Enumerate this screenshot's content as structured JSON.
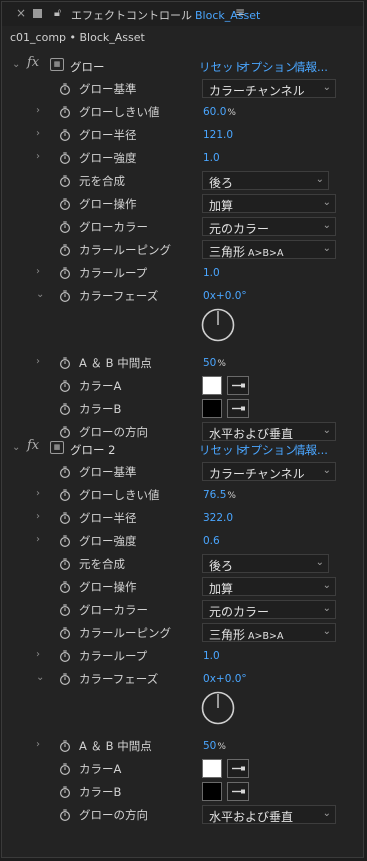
{
  "tab": {
    "title": "エフェクトコントロール",
    "asset": "Block_Asset"
  },
  "breadcrumb": "c01_comp • Block_Asset",
  "effects": [
    {
      "name": "グロー",
      "links": [
        "リセット",
        "オプション...",
        "情報..."
      ],
      "params": [
        {
          "label": "グロー基準",
          "type": "dropdown",
          "value": "カラーチャンネル"
        },
        {
          "label": "グローしきい値",
          "type": "number",
          "value": "60.0",
          "unit": "%",
          "expandable": true
        },
        {
          "label": "グロー半径",
          "type": "number",
          "value": "121.0",
          "expandable": true
        },
        {
          "label": "グロー強度",
          "type": "number",
          "value": "1.0",
          "expandable": true
        },
        {
          "label": "元を合成",
          "type": "dropdown",
          "value": "後ろ",
          "short": true
        },
        {
          "label": "グロー操作",
          "type": "dropdown",
          "value": "加算"
        },
        {
          "label": "グローカラー",
          "type": "dropdown",
          "value": "元のカラー"
        },
        {
          "label": "カラールーピング",
          "type": "dropdown",
          "value": "三角形",
          "value_suffix": "A>B>A"
        },
        {
          "label": "カラーループ",
          "type": "number",
          "value": "1.0",
          "expandable": true
        },
        {
          "label": "カラーフェーズ",
          "type": "angle",
          "value": "0",
          "value_extra": "x+0.0°",
          "expanded": true
        },
        {
          "label": "A ＆ B 中間点",
          "type": "number",
          "value": "50",
          "unit": "%",
          "expandable": true
        },
        {
          "label": "カラーA",
          "type": "color",
          "color": "#ffffff"
        },
        {
          "label": "カラーB",
          "type": "color",
          "color": "#000000"
        },
        {
          "label": "グローの方向",
          "type": "dropdown",
          "value": "水平および垂直"
        }
      ]
    },
    {
      "name": "グロー 2",
      "links": [
        "リセット",
        "オプション...",
        "情報..."
      ],
      "params": [
        {
          "label": "グロー基準",
          "type": "dropdown",
          "value": "カラーチャンネル"
        },
        {
          "label": "グローしきい値",
          "type": "number",
          "value": "76.5",
          "unit": "%",
          "expandable": true
        },
        {
          "label": "グロー半径",
          "type": "number",
          "value": "322.0",
          "expandable": true
        },
        {
          "label": "グロー強度",
          "type": "number",
          "value": "0.6",
          "expandable": true
        },
        {
          "label": "元を合成",
          "type": "dropdown",
          "value": "後ろ",
          "short": true
        },
        {
          "label": "グロー操作",
          "type": "dropdown",
          "value": "加算"
        },
        {
          "label": "グローカラー",
          "type": "dropdown",
          "value": "元のカラー"
        },
        {
          "label": "カラールーピング",
          "type": "dropdown",
          "value": "三角形",
          "value_suffix": "A>B>A"
        },
        {
          "label": "カラーループ",
          "type": "number",
          "value": "1.0",
          "expandable": true
        },
        {
          "label": "カラーフェーズ",
          "type": "angle",
          "value": "0",
          "value_extra": "x+0.0°",
          "expanded": true
        },
        {
          "label": "A ＆ B 中間点",
          "type": "number",
          "value": "50",
          "unit": "%",
          "expandable": true
        },
        {
          "label": "カラーA",
          "type": "color",
          "color": "#ffffff"
        },
        {
          "label": "カラーB",
          "type": "color",
          "color": "#000000"
        },
        {
          "label": "グローの方向",
          "type": "dropdown",
          "value": "水平および垂直"
        }
      ]
    }
  ]
}
